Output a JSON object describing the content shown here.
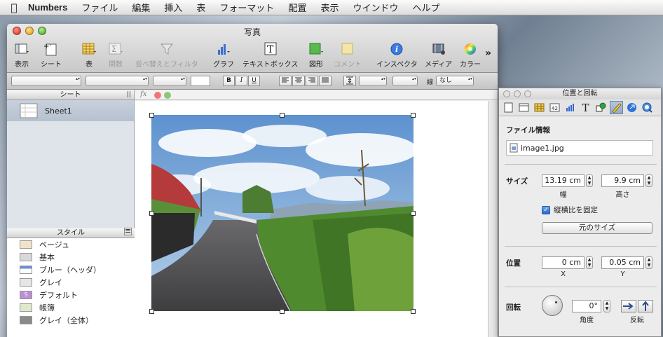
{
  "menubar": {
    "app": "Numbers",
    "items": [
      "ファイル",
      "編集",
      "挿入",
      "表",
      "フォーマット",
      "配置",
      "表示",
      "ウインドウ",
      "ヘルプ"
    ]
  },
  "window": {
    "title": "写真"
  },
  "toolbar": {
    "view": "表示",
    "sheet": "シート",
    "table": "表",
    "functions": "関数",
    "sort_filter": "並べ替えとフィルタ",
    "chart": "グラフ",
    "textbox": "テキストボックス",
    "shapes": "図形",
    "comment": "コメント",
    "inspector": "インスペクタ",
    "media": "メディア",
    "colors": "カラー"
  },
  "formatbar": {
    "bold": "B",
    "italic": "I",
    "underline": "U",
    "border_value": "なし",
    "border_label": "線"
  },
  "sidebar": {
    "sheets_header": "シート",
    "sheet_name": "Sheet1",
    "styles_header": "スタイル",
    "styles": [
      {
        "label": "ベージュ",
        "color": "#efe4c7"
      },
      {
        "label": "基本",
        "color": "#d9d9d9"
      },
      {
        "label": "ブルー（ヘッダ）",
        "color": "#6d8fd6"
      },
      {
        "label": "グレイ",
        "color": "#e6e6e6"
      },
      {
        "label": "デフォルト",
        "color": "#b98fd1"
      },
      {
        "label": "帳簿",
        "color": "#dde9c9"
      },
      {
        "label": "グレイ（全体）",
        "color": "#8a8a8a"
      }
    ]
  },
  "formula": {
    "fx": "fx"
  },
  "inspector": {
    "title": "位置と回転",
    "file_info_label": "ファイル情報",
    "file_name": "image1.jpg",
    "size_label": "サイズ",
    "width_value": "13.19 cm",
    "width_sub": "幅",
    "height_value": "9.9 cm",
    "height_sub": "高さ",
    "constrain_label": "縦横比を固定",
    "constrain_checked": true,
    "original_size_button": "元のサイズ",
    "position_label": "位置",
    "x_value": "0 cm",
    "x_sub": "X",
    "y_value": "0.05 cm",
    "y_sub": "Y",
    "rotate_label": "回転",
    "angle_value": "0°",
    "angle_sub": "角度",
    "flip_sub": "反転"
  }
}
